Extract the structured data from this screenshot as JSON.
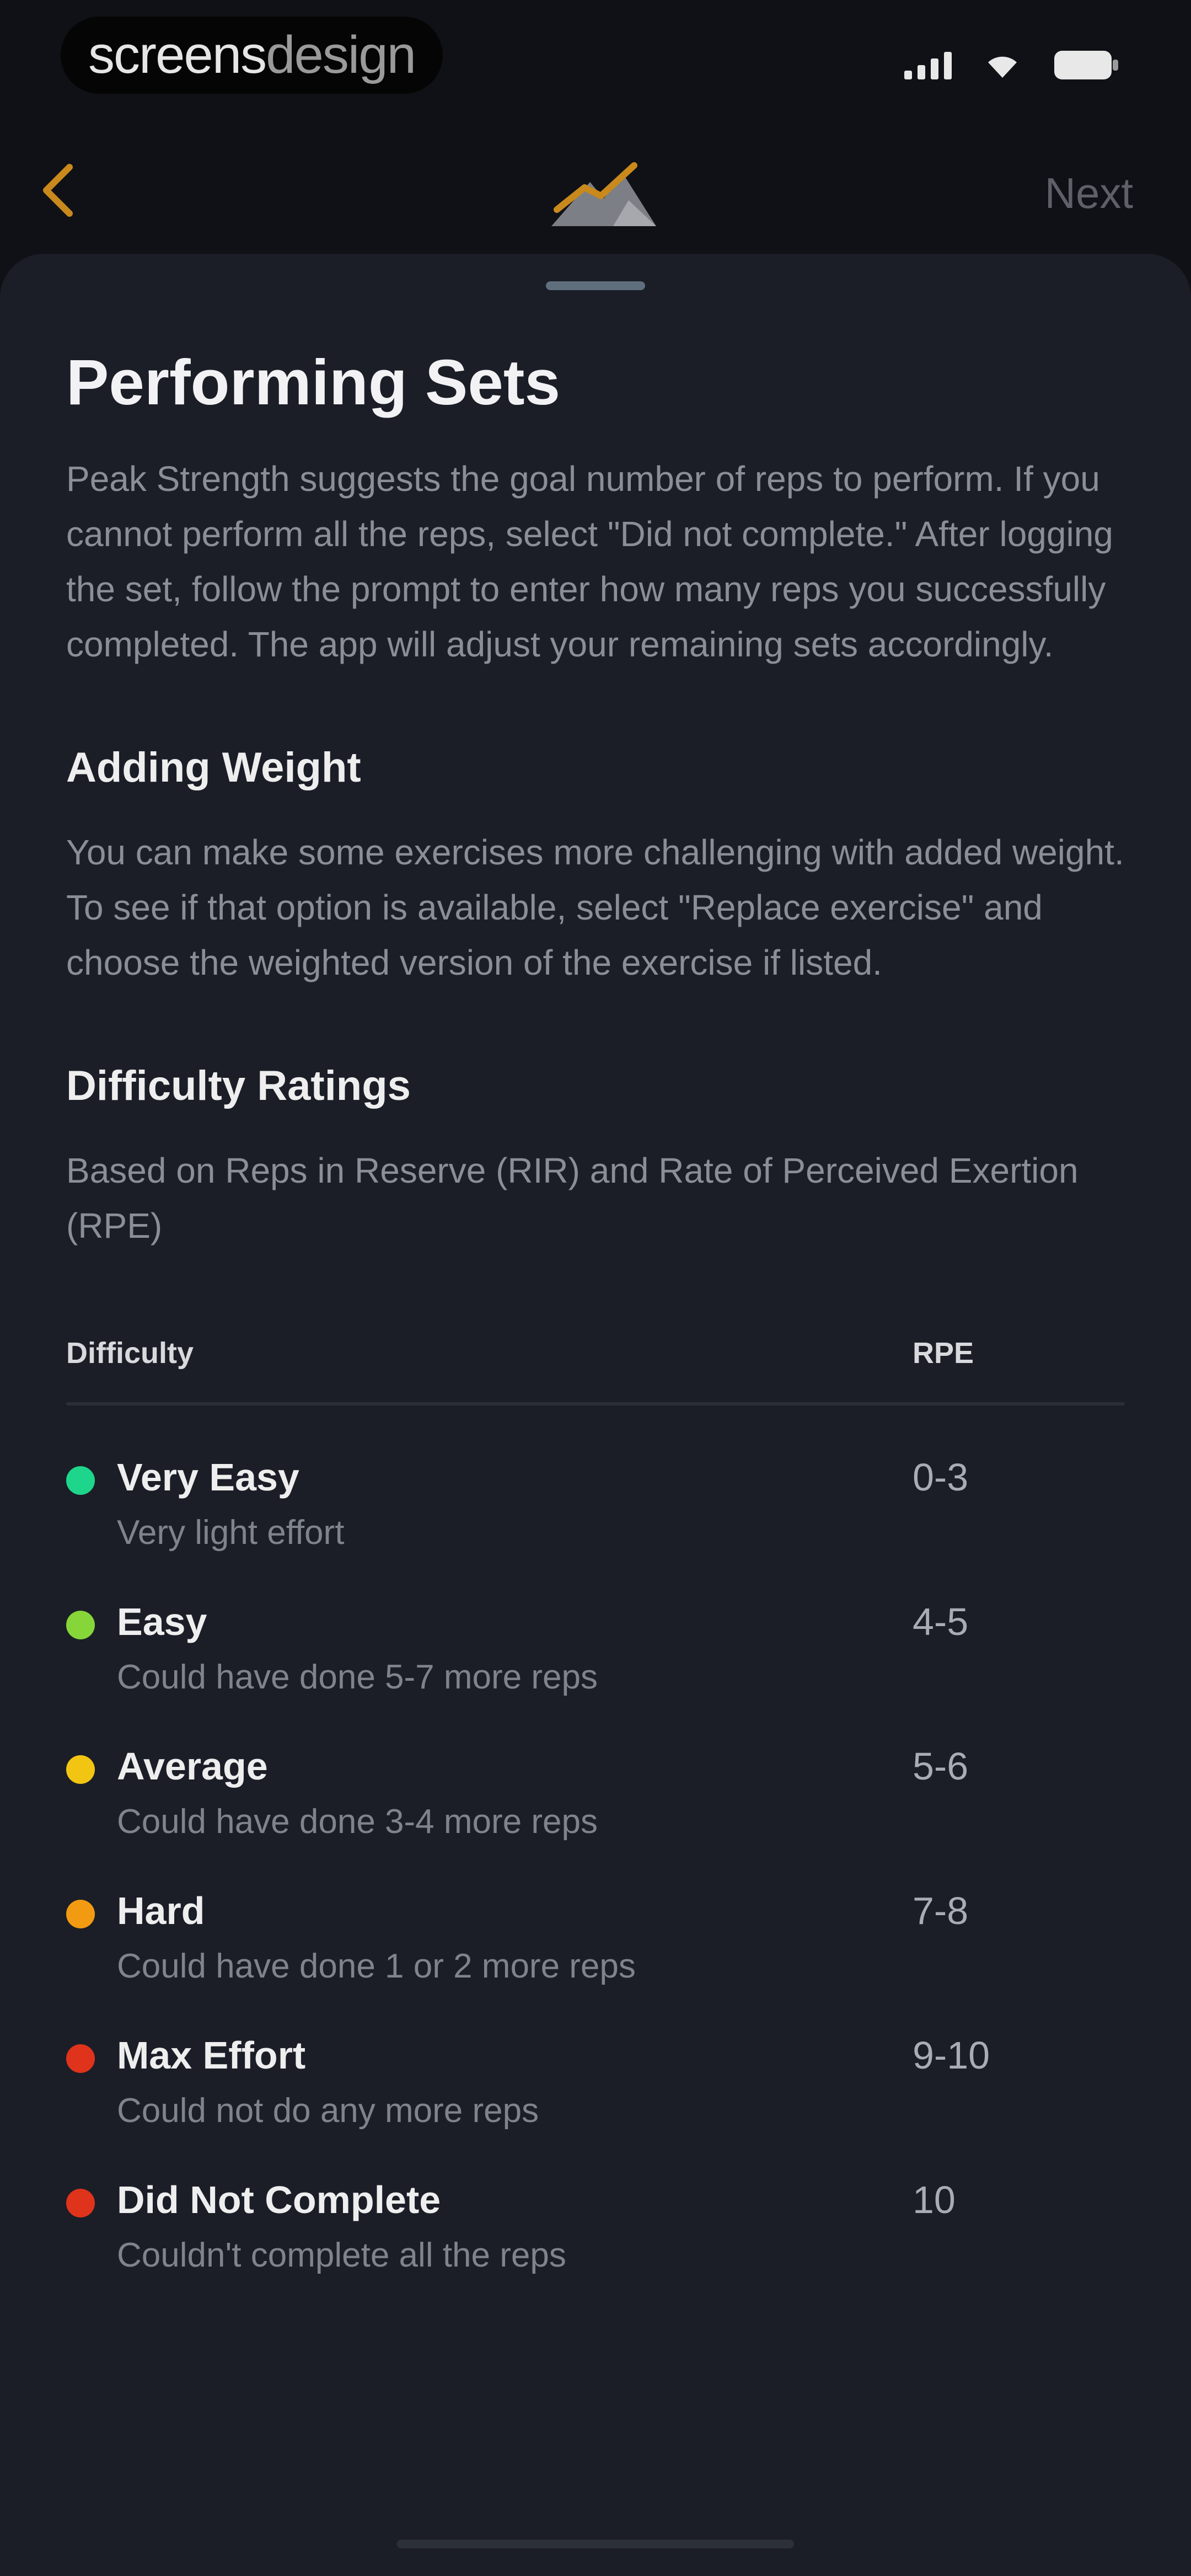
{
  "status_bar": {
    "watermark_bold": "screens",
    "watermark_light": "design",
    "icons": [
      "signal-icon",
      "wifi-icon",
      "battery-icon"
    ]
  },
  "nav": {
    "back_icon": "chevron-left-icon",
    "logo_icon": "mountain-logo-icon",
    "next_label": "Next",
    "accent_color": "#c9891c"
  },
  "sheet": {
    "title": "Performing Sets",
    "intro": "Peak Strength suggests the goal number of reps to perform. If you cannot perform all the reps, select \"Did not complete.\" After logging the set, follow the prompt to enter how many reps you successfully completed. The app will adjust your remaining sets accordingly.",
    "adding_weight": {
      "heading": "Adding Weight",
      "body": "You can make some exercises more challenging with added weight. To see if that option is available, select \"Replace exercise\" and choose the weighted version of the exercise if listed."
    },
    "difficulty": {
      "heading": "Difficulty Ratings",
      "body": "Based on Reps in Reserve (RIR) and Rate of Perceived Exertion (RPE)",
      "table_headers": {
        "left": "Difficulty",
        "right": "RPE"
      },
      "ratings": [
        {
          "name": "Very Easy",
          "desc": "Very light effort",
          "rpe": "0-3",
          "color": "#1ed68b"
        },
        {
          "name": "Easy",
          "desc": "Could have done 5-7 more reps",
          "rpe": "4-5",
          "color": "#86d63a"
        },
        {
          "name": "Average",
          "desc": "Could have done 3-4 more reps",
          "rpe": "5-6",
          "color": "#f2c513"
        },
        {
          "name": "Hard",
          "desc": "Could have done 1 or 2 more reps",
          "rpe": "7-8",
          "color": "#f29b12"
        },
        {
          "name": "Max Effort",
          "desc": "Could not do any more reps",
          "rpe": "9-10",
          "color": "#e0331c"
        },
        {
          "name": "Did Not Complete",
          "desc": "Couldn't complete all the reps",
          "rpe": "10",
          "color": "#e0331c"
        }
      ]
    }
  }
}
